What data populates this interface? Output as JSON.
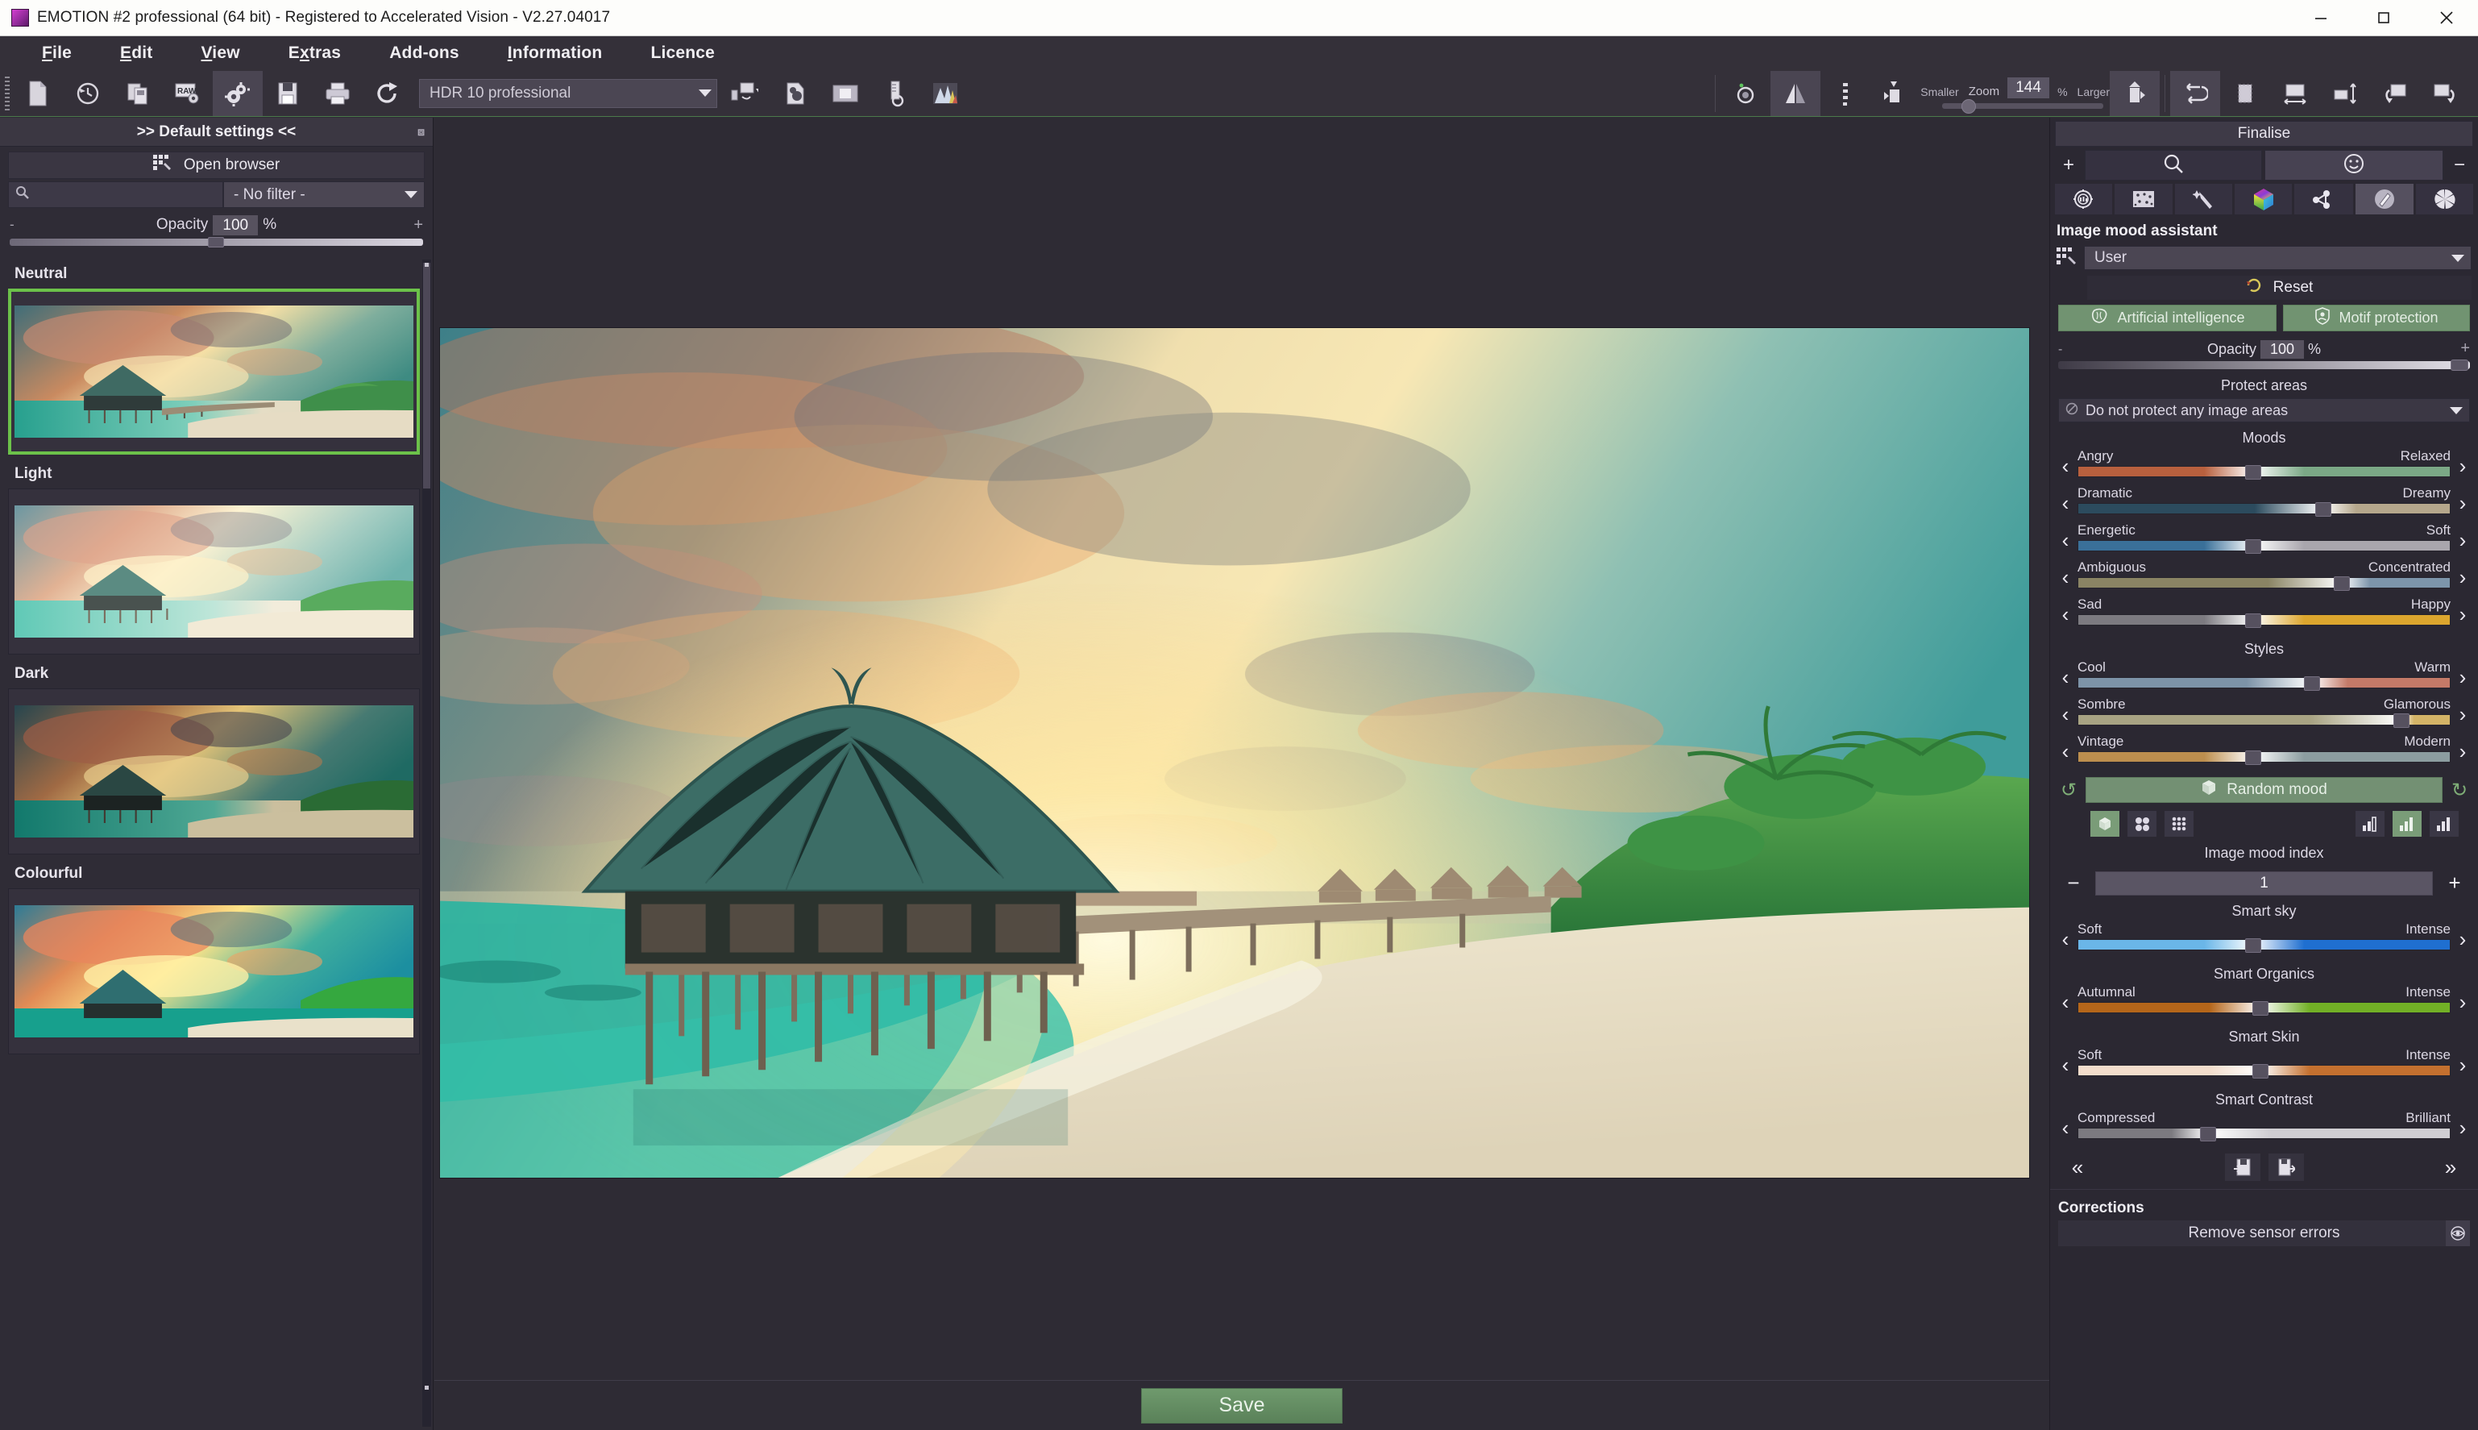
{
  "window": {
    "title": "EMOTION #2 professional (64 bit) - Registered to Accelerated Vision - V2.27.04017",
    "minimize": "minimize-icon",
    "maximize": "maximize-icon",
    "close": "close-icon"
  },
  "menu": [
    {
      "label": "File",
      "accel": "F"
    },
    {
      "label": "Edit",
      "accel": "E"
    },
    {
      "label": "View",
      "accel": "V"
    },
    {
      "label": "Extras",
      "accel": "x"
    },
    {
      "label": "Add-ons",
      "accel": ""
    },
    {
      "label": "Information",
      "accel": "I"
    },
    {
      "label": "Licence",
      "accel": ""
    }
  ],
  "toolbar": {
    "left_tools": [
      {
        "name": "new-document-icon"
      },
      {
        "name": "history-icon"
      },
      {
        "name": "batch-copy-icon"
      },
      {
        "name": "raw-settings-icon"
      },
      {
        "name": "gears-settings-icon",
        "active": true
      },
      {
        "name": "save-disk-icon"
      },
      {
        "name": "print-icon"
      },
      {
        "name": "share-export-icon"
      }
    ],
    "preset_combo": "HDR 10 professional",
    "right_tools": [
      {
        "name": "monitor-profile-icon"
      },
      {
        "name": "selective-edit-icon"
      },
      {
        "name": "compare-view-icon"
      },
      {
        "name": "measure-probe-icon"
      },
      {
        "name": "histogram-icon"
      }
    ],
    "view_tools": [
      {
        "name": "hand-preview-icon"
      },
      {
        "name": "mirror-compare-icon",
        "active": true
      },
      {
        "name": "grain-noise-icon"
      },
      {
        "name": "fit-smaller-icon"
      }
    ],
    "zoom": {
      "smaller_label": "Smaller",
      "zoom_label": "Zoom",
      "value": "144",
      "percent": "%",
      "larger_label": "Larger"
    },
    "fit_tools": [
      {
        "name": "fit-window-icon",
        "active": true
      },
      {
        "name": "fit-actual-size-icon"
      },
      {
        "name": "fit-width-icon"
      },
      {
        "name": "fit-height-icon"
      },
      {
        "name": "rotate-left-icon"
      },
      {
        "name": "rotate-right-icon"
      }
    ]
  },
  "left_panel": {
    "header": ">> Default settings <<",
    "open_browser": "Open browser",
    "search_placeholder": "",
    "filter_value": "- No filter -",
    "opacity": {
      "label": "Opacity",
      "value": "100",
      "unit": "%",
      "minus": "-",
      "plus": "+"
    },
    "groups": [
      {
        "label": "Neutral",
        "selected": true
      },
      {
        "label": "Light",
        "selected": false
      },
      {
        "label": "Dark",
        "selected": false
      },
      {
        "label": "Colourful",
        "selected": false
      }
    ]
  },
  "center": {
    "save_label": "Save"
  },
  "right_panel": {
    "finalise": "Finalise",
    "mode_plus": "+",
    "mode_minus": "−",
    "mode_tabs": [
      {
        "name": "search-magnifier-icon",
        "active": false
      },
      {
        "name": "smiley-mood-icon",
        "active": true
      }
    ],
    "tool_icons": [
      {
        "name": "exposure-gear-icon",
        "active": false
      },
      {
        "name": "noise-grain-icon",
        "active": false
      },
      {
        "name": "sharpen-wand-icon",
        "active": false
      },
      {
        "name": "color-cube-icon",
        "active": false
      },
      {
        "name": "nodes-network-icon",
        "active": false
      },
      {
        "name": "retouch-brush-icon",
        "active": true
      },
      {
        "name": "aperture-icon",
        "active": false
      }
    ],
    "assistant_title": "Image mood assistant",
    "assistant_preset": "User",
    "reset_label": "Reset",
    "ai_button": "Artificial intelligence",
    "motif_button": "Motif protection",
    "opacity": {
      "label": "Opacity",
      "value": "100",
      "unit": "%",
      "minus": "-",
      "plus": "+"
    },
    "protect_areas_label": "Protect areas",
    "protect_areas_value": "Do not protect any image areas",
    "moods_title": "Moods",
    "moods": [
      {
        "left": "Angry",
        "right": "Relaxed",
        "pos": 47,
        "colorL": "#b8603e",
        "colorR": "#7ba886"
      },
      {
        "left": "Dramatic",
        "right": "Dreamy",
        "pos": 66,
        "colorL": "#2c4b5e",
        "colorR": "#b5a78c"
      },
      {
        "left": "Energetic",
        "right": "Soft",
        "pos": 47,
        "colorL": "#3a7099",
        "colorR": "#a9a6ad"
      },
      {
        "left": "Ambiguous",
        "right": "Concentrated",
        "pos": 71,
        "colorL": "#8a8464",
        "colorR": "#7d95ab"
      },
      {
        "left": "Sad",
        "right": "Happy",
        "pos": 47,
        "colorL": "#7c7a80",
        "colorR": "#dca62e"
      }
    ],
    "styles_title": "Styles",
    "styles": [
      {
        "left": "Cool",
        "right": "Warm",
        "pos": 63,
        "colorL": "#7d93a8",
        "colorR": "#c47a68"
      },
      {
        "left": "Sombre",
        "right": "Glamorous",
        "pos": 87,
        "colorL": "#a8a383",
        "colorR": "#d4b467"
      },
      {
        "left": "Vintage",
        "right": "Modern",
        "pos": 47,
        "colorL": "#bc8e4e",
        "colorR": "#8c9da0"
      }
    ],
    "random_mood": "Random mood",
    "undo_icon": "undo-arrow-icon",
    "redo_icon": "redo-arrow-icon",
    "view_modes": [
      {
        "name": "single-view-icon",
        "active": true
      },
      {
        "name": "four-up-view-icon",
        "active": false
      },
      {
        "name": "nine-up-view-icon",
        "active": false
      }
    ],
    "strength_modes": [
      {
        "name": "strength-low-icon",
        "active": false
      },
      {
        "name": "strength-medium-icon",
        "active": true
      },
      {
        "name": "strength-high-icon",
        "active": false
      }
    ],
    "index_label": "Image mood index",
    "index_value": "1",
    "index_minus": "−",
    "index_plus": "+",
    "smart": [
      {
        "title": "Smart sky",
        "left": "Soft",
        "right": "Intense",
        "pos": 47,
        "colorL": "#6ab6e8",
        "colorR": "#1f6fd0"
      },
      {
        "title": "Smart Organics",
        "left": "Autumnal",
        "right": "Intense",
        "pos": 49,
        "colorL": "#b5661a",
        "colorR": "#72b026"
      },
      {
        "title": "Smart Skin",
        "left": "Soft",
        "right": "Intense",
        "pos": 49,
        "colorL": "#f3ddcc",
        "colorR": "#c4702f"
      },
      {
        "title": "Smart Contrast",
        "left": "Compressed",
        "right": "Brilliant",
        "pos": 35,
        "colorL": "#7c7a80",
        "colorR": "#cfcdd2"
      }
    ],
    "nav_prev": "«",
    "nav_next": "»",
    "nav_icons": [
      {
        "name": "load-settings-icon"
      },
      {
        "name": "save-settings-icon"
      }
    ],
    "corrections_title": "Corrections",
    "remove_sensor_errors": "Remove sensor errors",
    "sensor_eye_icon": "eye-preview-icon"
  },
  "colors": {
    "accent_green": "#6cc24a",
    "button_green": "#719371",
    "panel_bg": "#2f2c36",
    "toolbar_bg": "#343039",
    "titlebar_bg": "#fdfdfb"
  }
}
